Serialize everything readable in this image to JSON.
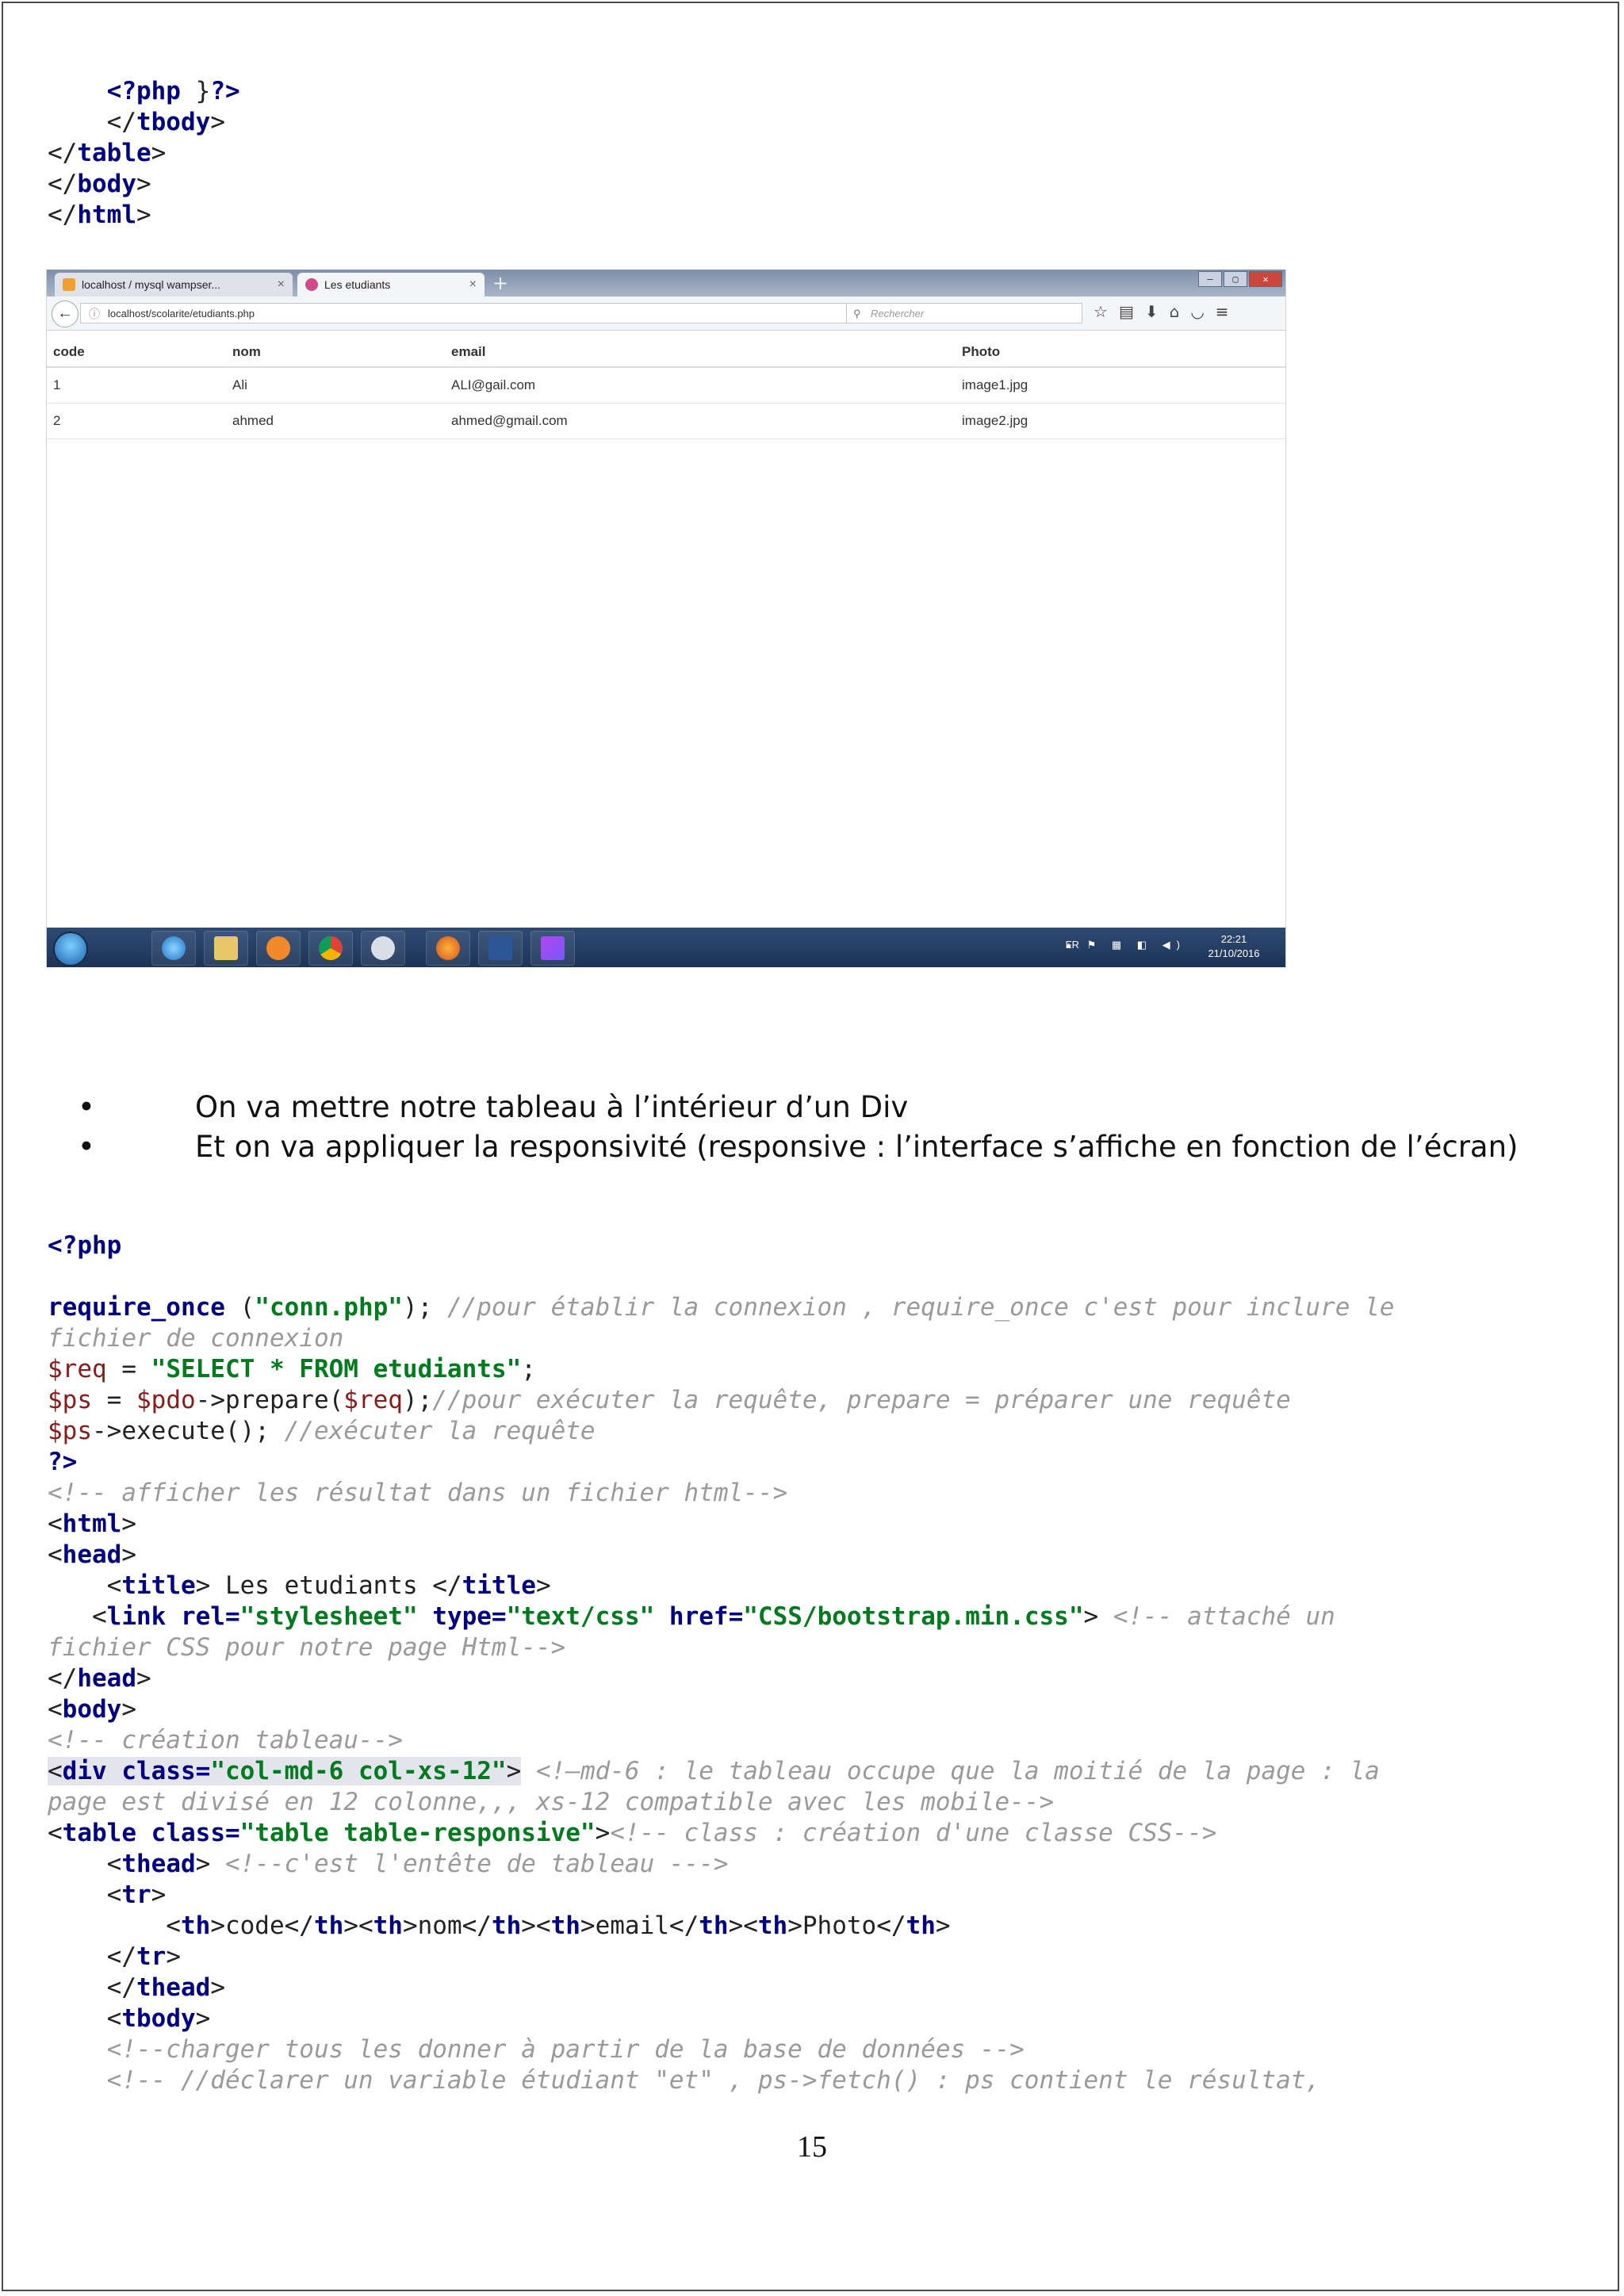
{
  "code_top": [
    [
      {
        "t": "    "
      },
      {
        "t": "<?php",
        "c": "kw"
      },
      {
        "t": " }"
      },
      {
        "t": "?>",
        "c": "kw"
      }
    ],
    [
      {
        "t": "    </"
      },
      {
        "t": "tbody",
        "c": "kw"
      },
      {
        "t": ">"
      }
    ],
    [
      {
        "t": "</"
      },
      {
        "t": "table",
        "c": "kw"
      },
      {
        "t": ">"
      }
    ],
    [
      {
        "t": "</"
      },
      {
        "t": "body",
        "c": "kw"
      },
      {
        "t": ">"
      }
    ],
    [
      {
        "t": "</"
      },
      {
        "t": "html",
        "c": "kw"
      },
      {
        "t": ">"
      }
    ]
  ],
  "browser": {
    "tabs": [
      {
        "label": "localhost / mysql wampser...",
        "close": "×"
      },
      {
        "label": "Les etudiants",
        "close": "×"
      }
    ],
    "new_tab": "+",
    "url": "localhost/scolarite/etudiants.php",
    "search_placeholder": "Rechercher",
    "table": {
      "headers": [
        "code",
        "nom",
        "email",
        "Photo"
      ],
      "rows": [
        [
          "1",
          "Ali",
          "ALI@gail.com",
          "image1.jpg"
        ],
        [
          "2",
          "ahmed",
          "ahmed@gmail.com",
          "image2.jpg"
        ]
      ]
    },
    "taskbar": {
      "lang": "FR",
      "time": "22:21",
      "date": "21/10/2016"
    }
  },
  "bullets": [
    "On va mettre notre tableau à l’intérieur d’un  Div",
    "Et on va appliquer la responsivité (responsive : l’interface s’affiche en fonction de l’écran)"
  ],
  "code_main": [
    [
      {
        "t": "<?php",
        "c": "kw"
      }
    ],
    [
      {
        "t": ""
      }
    ],
    [
      {
        "t": "require_once",
        "c": "kw"
      },
      {
        "t": " ("
      },
      {
        "t": "\"conn.php\"",
        "c": "str"
      },
      {
        "t": "); "
      },
      {
        "t": "//pour établir la connexion , require_once c'est pour inclure le",
        "c": "cmt"
      }
    ],
    [
      {
        "t": "fichier de connexion",
        "c": "cmt"
      }
    ],
    [
      {
        "t": "$req",
        "c": "var"
      },
      {
        "t": " = "
      },
      {
        "t": "\"SELECT * FROM etudiants\"",
        "c": "str"
      },
      {
        "t": ";"
      }
    ],
    [
      {
        "t": "$ps",
        "c": "var"
      },
      {
        "t": " = "
      },
      {
        "t": "$pdo",
        "c": "var"
      },
      {
        "t": "->prepare("
      },
      {
        "t": "$req",
        "c": "var"
      },
      {
        "t": ");"
      },
      {
        "t": "//pour exécuter la requête, prepare = préparer une requête",
        "c": "cmt"
      }
    ],
    [
      {
        "t": "$ps",
        "c": "var"
      },
      {
        "t": "->execute(); "
      },
      {
        "t": "//exécuter la requête",
        "c": "cmt"
      }
    ],
    [
      {
        "t": "?>",
        "c": "kw"
      }
    ],
    [
      {
        "t": "<!-- afficher les résultat dans un fichier html-->",
        "c": "cmt"
      }
    ],
    [
      {
        "t": "<"
      },
      {
        "t": "html",
        "c": "kw"
      },
      {
        "t": ">"
      }
    ],
    [
      {
        "t": "<"
      },
      {
        "t": "head",
        "c": "kw"
      },
      {
        "t": ">"
      }
    ],
    [
      {
        "t": "    <"
      },
      {
        "t": "title",
        "c": "kw"
      },
      {
        "t": "> Les etudiants </"
      },
      {
        "t": "title",
        "c": "kw"
      },
      {
        "t": ">"
      }
    ],
    [
      {
        "t": "   <"
      },
      {
        "t": "link",
        "c": "kw"
      },
      {
        "t": " "
      },
      {
        "t": "rel=",
        "c": "kw"
      },
      {
        "t": "\"stylesheet\"",
        "c": "str"
      },
      {
        "t": " "
      },
      {
        "t": "type=",
        "c": "kw"
      },
      {
        "t": "\"text/css\"",
        "c": "str"
      },
      {
        "t": " "
      },
      {
        "t": "href=",
        "c": "kw"
      },
      {
        "t": "\"CSS/bootstrap.min.css\"",
        "c": "str"
      },
      {
        "t": "> "
      },
      {
        "t": "<!-- attaché un",
        "c": "cmt"
      }
    ],
    [
      {
        "t": "fichier CSS pour notre page Html-->",
        "c": "cmt"
      }
    ],
    [
      {
        "t": "</"
      },
      {
        "t": "head",
        "c": "kw"
      },
      {
        "t": ">"
      }
    ],
    [
      {
        "t": "<"
      },
      {
        "t": "body",
        "c": "kw"
      },
      {
        "t": ">"
      }
    ],
    [
      {
        "t": "<!-- création tableau-->",
        "c": "cmt"
      }
    ],
    [
      {
        "t": "<",
        "h": 1
      },
      {
        "t": "div",
        "c": "kw",
        "h": 1
      },
      {
        "t": " ",
        "h": 1
      },
      {
        "t": "class=",
        "c": "kw",
        "h": 1
      },
      {
        "t": "\"col-md-6 col-xs-12\"",
        "c": "str",
        "h": 1
      },
      {
        "t": ">",
        "h": 1
      },
      {
        "t": " "
      },
      {
        "t": "<!—md-6 : le tableau occupe que la moitié de la page : la",
        "c": "cmt"
      }
    ],
    [
      {
        "t": "page est divisé en 12 colonne,,, xs-12 compatible avec les mobile-->",
        "c": "cmt"
      }
    ],
    [
      {
        "t": "<"
      },
      {
        "t": "table",
        "c": "kw"
      },
      {
        "t": " "
      },
      {
        "t": "class=",
        "c": "kw"
      },
      {
        "t": "\"table table-responsive\"",
        "c": "str"
      },
      {
        "t": ">"
      },
      {
        "t": "<!-- class : création d'une classe CSS-->",
        "c": "cmt"
      }
    ],
    [
      {
        "t": "    <"
      },
      {
        "t": "thead",
        "c": "kw"
      },
      {
        "t": "> "
      },
      {
        "t": "<!--c'est l'entête de tableau --->",
        "c": "cmt"
      }
    ],
    [
      {
        "t": "    <"
      },
      {
        "t": "tr",
        "c": "kw"
      },
      {
        "t": ">"
      }
    ],
    [
      {
        "t": "        <"
      },
      {
        "t": "th",
        "c": "kw"
      },
      {
        "t": ">code</"
      },
      {
        "t": "th",
        "c": "kw"
      },
      {
        "t": "><"
      },
      {
        "t": "th",
        "c": "kw"
      },
      {
        "t": ">nom</"
      },
      {
        "t": "th",
        "c": "kw"
      },
      {
        "t": "><"
      },
      {
        "t": "th",
        "c": "kw"
      },
      {
        "t": ">email</"
      },
      {
        "t": "th",
        "c": "kw"
      },
      {
        "t": "><"
      },
      {
        "t": "th",
        "c": "kw"
      },
      {
        "t": ">Photo</"
      },
      {
        "t": "th",
        "c": "kw"
      },
      {
        "t": ">"
      }
    ],
    [
      {
        "t": "    </"
      },
      {
        "t": "tr",
        "c": "kw"
      },
      {
        "t": ">"
      }
    ],
    [
      {
        "t": "    </"
      },
      {
        "t": "thead",
        "c": "kw"
      },
      {
        "t": ">"
      }
    ],
    [
      {
        "t": "    <"
      },
      {
        "t": "tbody",
        "c": "kw"
      },
      {
        "t": ">"
      }
    ],
    [
      {
        "t": "    "
      },
      {
        "t": "<!--charger tous les donner à partir de la base de données -->",
        "c": "cmt"
      }
    ],
    [
      {
        "t": "    "
      },
      {
        "t": "<!-- //déclarer un variable étudiant \"et\" , ps->fetch() : ps contient le résultat,",
        "c": "cmt"
      }
    ]
  ],
  "page_number": "15",
  "colors": {
    "keyword": "#000080",
    "string": "#007a1f",
    "variable": "#8b1a1a",
    "comment": "#9a9a9a"
  }
}
